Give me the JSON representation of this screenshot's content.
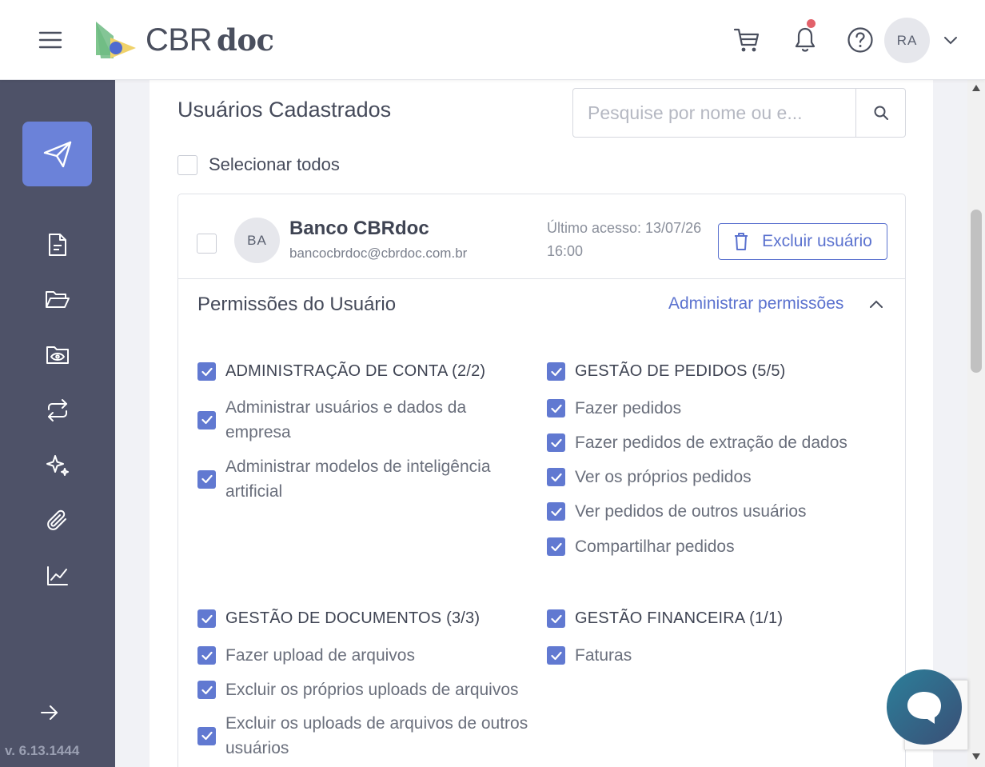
{
  "header": {
    "logo_cbr": "CBR",
    "logo_doc": "doc",
    "avatar_initials": "RA"
  },
  "sidebar": {
    "version": "v. 6.13.1444",
    "items": [
      {
        "icon": "send-icon",
        "active": true
      },
      {
        "icon": "document-icon"
      },
      {
        "icon": "folder-open-icon"
      },
      {
        "icon": "folder-eye-icon"
      },
      {
        "icon": "repeat-icon"
      },
      {
        "icon": "sparkles-icon"
      },
      {
        "icon": "paperclip-icon"
      },
      {
        "icon": "chart-line-icon"
      },
      {
        "icon": "arrow-right-icon"
      }
    ]
  },
  "main": {
    "title": "Usuários Cadastrados",
    "search_placeholder": "Pesquise por nome ou e...",
    "select_all_label": "Selecionar todos"
  },
  "user": {
    "initials": "BA",
    "name": "Banco CBRdoc",
    "email": "bancocbrdoc@cbrdoc.com.br",
    "last_access_line1": "Último acesso: 13/07/26",
    "last_access_line2": "16:00",
    "delete_label": "Excluir usuário"
  },
  "permissions": {
    "title": "Permissões do Usuário",
    "admin_link": "Administrar permissões",
    "groups": {
      "account": {
        "title": "ADMINISTRAÇÃO DE CONTA (2/2)",
        "items": [
          {
            "line1": "Administrar usuários e dados da",
            "line2": "empresa"
          },
          {
            "line1": "Administrar modelos de inteligência",
            "line2": "artificial"
          }
        ]
      },
      "orders": {
        "title": "GESTÃO DE PEDIDOS (5/5)",
        "items": [
          "Fazer pedidos",
          "Fazer pedidos de extração de dados",
          "Ver os próprios pedidos",
          "Ver pedidos de outros usuários",
          "Compartilhar pedidos"
        ]
      },
      "documents": {
        "title": "GESTÃO DE DOCUMENTOS (3/3)",
        "items": [
          {
            "line1": "Fazer upload de arquivos"
          },
          {
            "line1": "Excluir os próprios uploads de arquivos"
          },
          {
            "line1": "Excluir os uploads de arquivos de outros",
            "line2": "usuários"
          }
        ]
      },
      "finance": {
        "title": "GESTÃO FINANCEIRA (1/1)",
        "items": [
          "Faturas"
        ]
      }
    }
  },
  "colors": {
    "accent": "#6179d1",
    "sidebar": "#4e5268",
    "sidebar_active": "#6b82d9",
    "notification_dot": "#e2616a"
  }
}
